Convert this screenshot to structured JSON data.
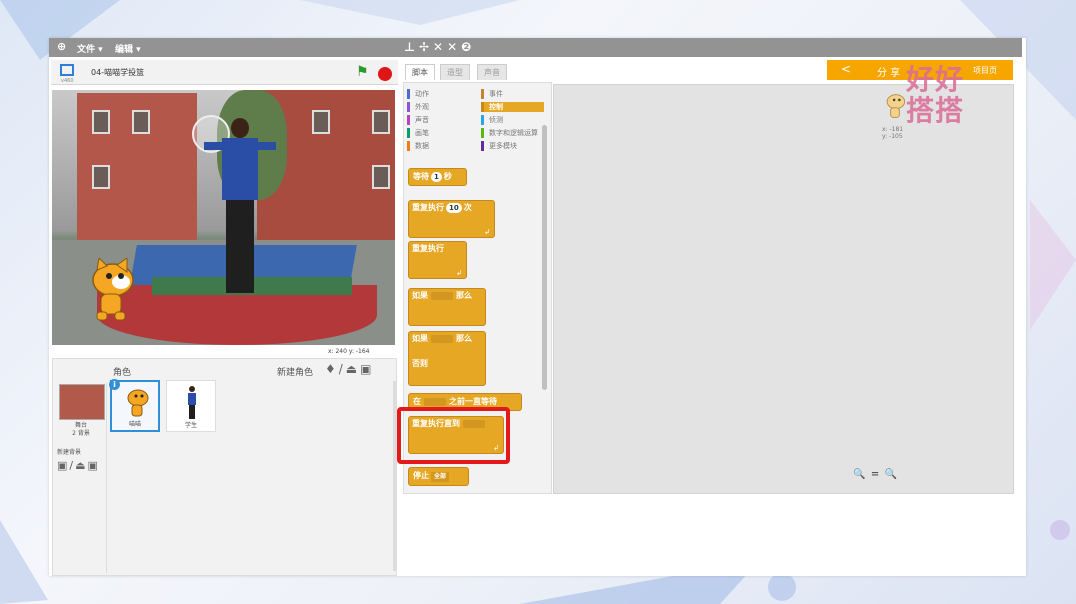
{
  "menubar": {
    "globe_icon": "globe-icon",
    "file": "文件 ▾",
    "edit": "编辑 ▾",
    "tool_icons": [
      "duplicate-icon",
      "cut-icon",
      "grow-icon",
      "shrink-icon",
      "help-icon"
    ],
    "tools_glyphs": "⊥✢✕✕❷"
  },
  "stage_header": {
    "version": "v460",
    "project_title": "04-喵喵学投篮",
    "flag_glyph": "⚑"
  },
  "stage": {
    "mouse_xy": "x: 240  y: -164"
  },
  "sprites_panel": {
    "sprites_label": "角色",
    "new_sprite_label": "新建角色",
    "new_sprite_icons_glyphs": "♦/⏏▣",
    "stage_label_line1": "舞台",
    "stage_label_line2": "2 背景",
    "new_backdrop_label": "新建背景",
    "new_backdrop_icons_glyphs": "▣/⏏▣",
    "sprites": [
      {
        "name": "喵喵",
        "selected": true
      },
      {
        "name": "学生",
        "selected": false
      }
    ],
    "info_glyph": "i"
  },
  "tabs": [
    "脚本",
    "造型",
    "声音"
  ],
  "categories": {
    "left": [
      "动作",
      "外观",
      "声音",
      "画笔",
      "数据"
    ],
    "right": [
      "事件",
      "控制",
      "侦测",
      "数字和逻辑运算",
      "更多模块"
    ],
    "active": "控制",
    "colors": {
      "动作": "#4a6cd4",
      "外观": "#8a55d7",
      "声音": "#bb42c3",
      "画笔": "#0e9a6c",
      "数据": "#ee7d16",
      "事件": "#c88330",
      "控制": "#e6a724",
      "侦测": "#2ca5e2",
      "数字和逻辑运算": "#5cb712",
      "更多模块": "#632d99"
    }
  },
  "blocks": {
    "wait": {
      "label": "等待",
      "value": "1",
      "unit": "秒"
    },
    "repeat": {
      "label": "重复执行",
      "value": "10",
      "unit": "次"
    },
    "forever": {
      "label": "重复执行"
    },
    "if_then": {
      "label": "如果",
      "then": "那么"
    },
    "if_else": {
      "label": "如果",
      "then": "那么",
      "else": "否则"
    },
    "wait_until": {
      "label": "在",
      "suffix": "之前一直等待"
    },
    "repeat_until": {
      "label": "重复执行直到"
    },
    "stop": {
      "label": "停止",
      "option": "全部"
    }
  },
  "share_bar": {
    "share_icon": "share-icon",
    "share_glyph": "<",
    "share_label": "分 享",
    "home_label": "项目页"
  },
  "script_area": {
    "sprite_x": "x: -181",
    "sprite_y": "y: -105",
    "zoom_glyphs": "🔍 = 🔍"
  },
  "watermark": {
    "line1": "好好",
    "line2": "搭搭"
  },
  "colors": {
    "control": "#e6a724",
    "highlight": "#e41919",
    "share": "#f7a600",
    "menubar": "#939393"
  }
}
